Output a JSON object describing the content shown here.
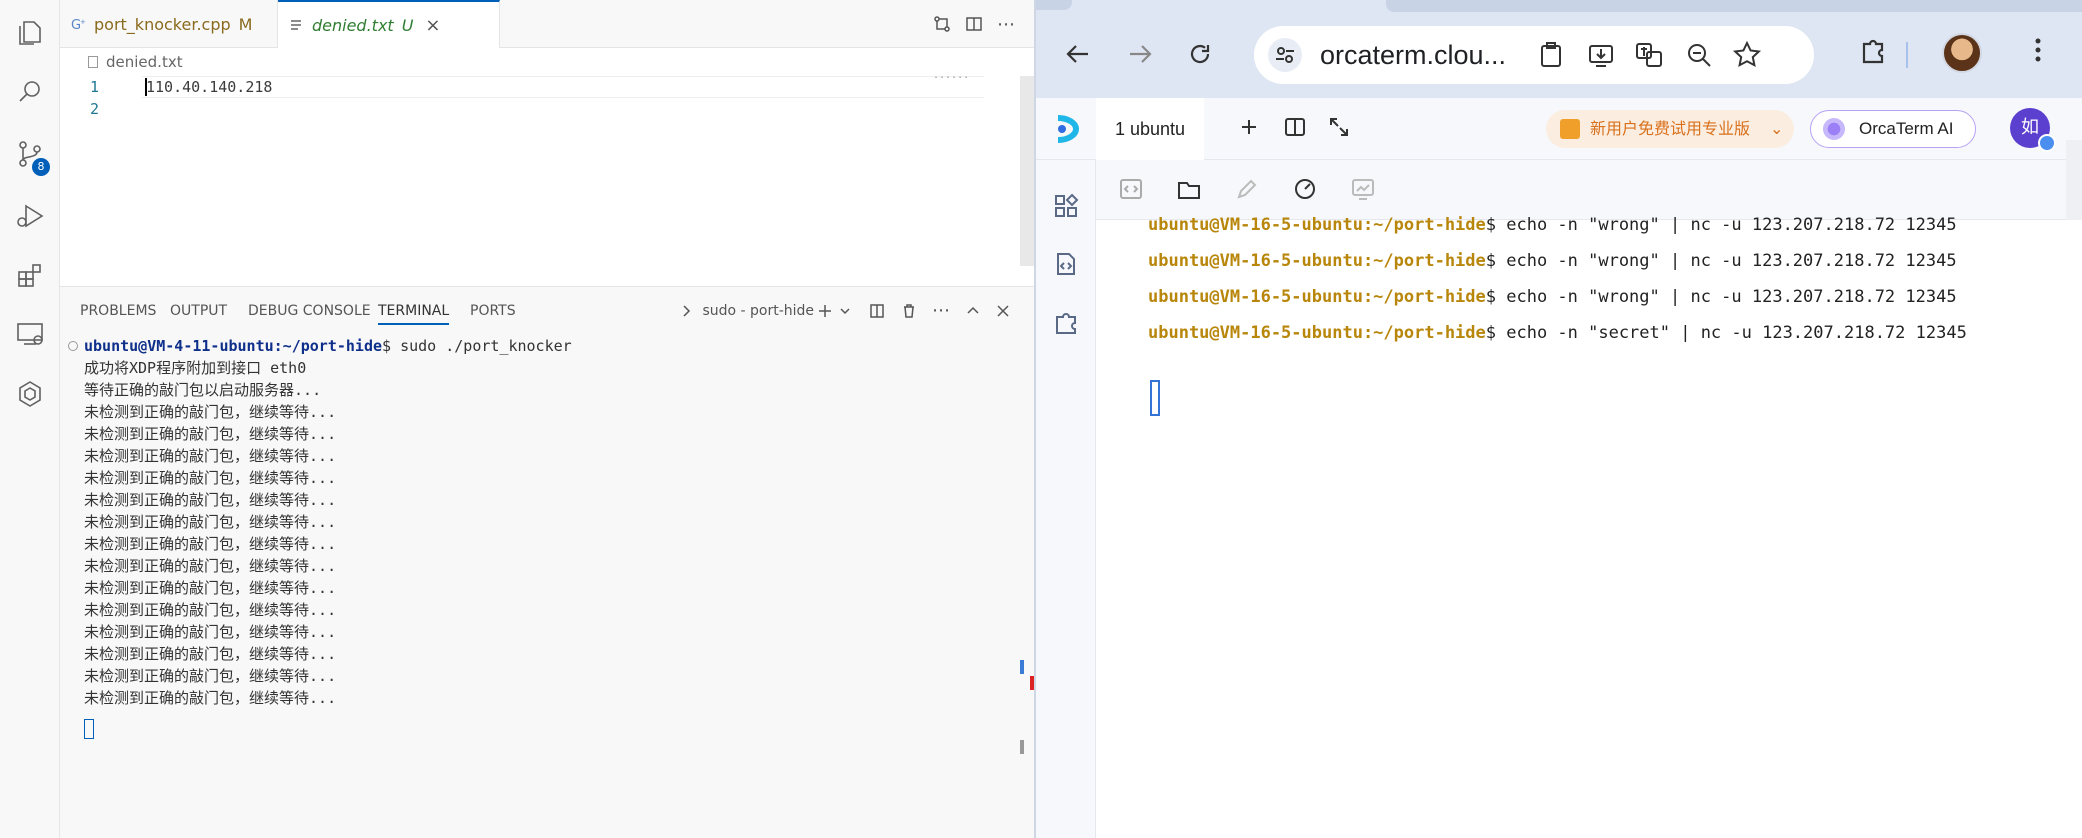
{
  "vscode": {
    "activity": {
      "source_control_badge": "8"
    },
    "tabs": [
      {
        "name": "port_knocker.cpp",
        "status": "M"
      },
      {
        "name": "denied.txt",
        "status": "U"
      }
    ],
    "breadcrumb": "denied.txt",
    "editor_lines": [
      {
        "num": "1",
        "text": "110.40.140.218"
      },
      {
        "num": "2",
        "text": ""
      }
    ],
    "minimap_hint": "......",
    "panel": {
      "tabs": [
        "PROBLEMS",
        "OUTPUT",
        "DEBUG CONSOLE",
        "TERMINAL",
        "PORTS"
      ],
      "active_tab": "TERMINAL",
      "terminal_name": "sudo - port-hide",
      "terminal": {
        "prompt_user": "ubuntu@VM-4-11-ubuntu",
        "prompt_path": ":~/port-hide",
        "prompt_cmd": "$ sudo ./port_knocker",
        "lines": [
          "成功将XDP程序附加到接口 eth0",
          "等待正确的敲门包以启动服务器...",
          "未检测到正确的敲门包，继续等待...",
          "未检测到正确的敲门包，继续等待...",
          "未检测到正确的敲门包，继续等待...",
          "未检测到正确的敲门包，继续等待...",
          "未检测到正确的敲门包，继续等待...",
          "未检测到正确的敲门包，继续等待...",
          "未检测到正确的敲门包，继续等待...",
          "未检测到正确的敲门包，继续等待...",
          "未检测到正确的敲门包，继续等待...",
          "未检测到正确的敲门包，继续等待...",
          "未检测到正确的敲门包，继续等待...",
          "未检测到正确的敲门包，继续等待...",
          "未检测到正确的敲门包，继续等待...",
          "未检测到正确的敲门包，继续等待..."
        ]
      }
    }
  },
  "browser": {
    "url": "orcaterm.clou...",
    "term_tab": "1  ubuntu",
    "promo": "新用户免费试用专业版",
    "ai_button": "OrcaTerm AI",
    "user_initial": "如",
    "terminal": {
      "prompt_user": "ubuntu@VM-16-5-ubuntu",
      "prompt_path": ":~/port-hide",
      "commands": [
        "$ echo -n \"wrong\" | nc -u 123.207.218.72 12345",
        "$ echo -n \"wrong\" | nc -u 123.207.218.72 12345",
        "$ echo -n \"wrong\" | nc -u 123.207.218.72 12345",
        "$ echo -n \"secret\" | nc -u 123.207.218.72 12345"
      ]
    }
  }
}
